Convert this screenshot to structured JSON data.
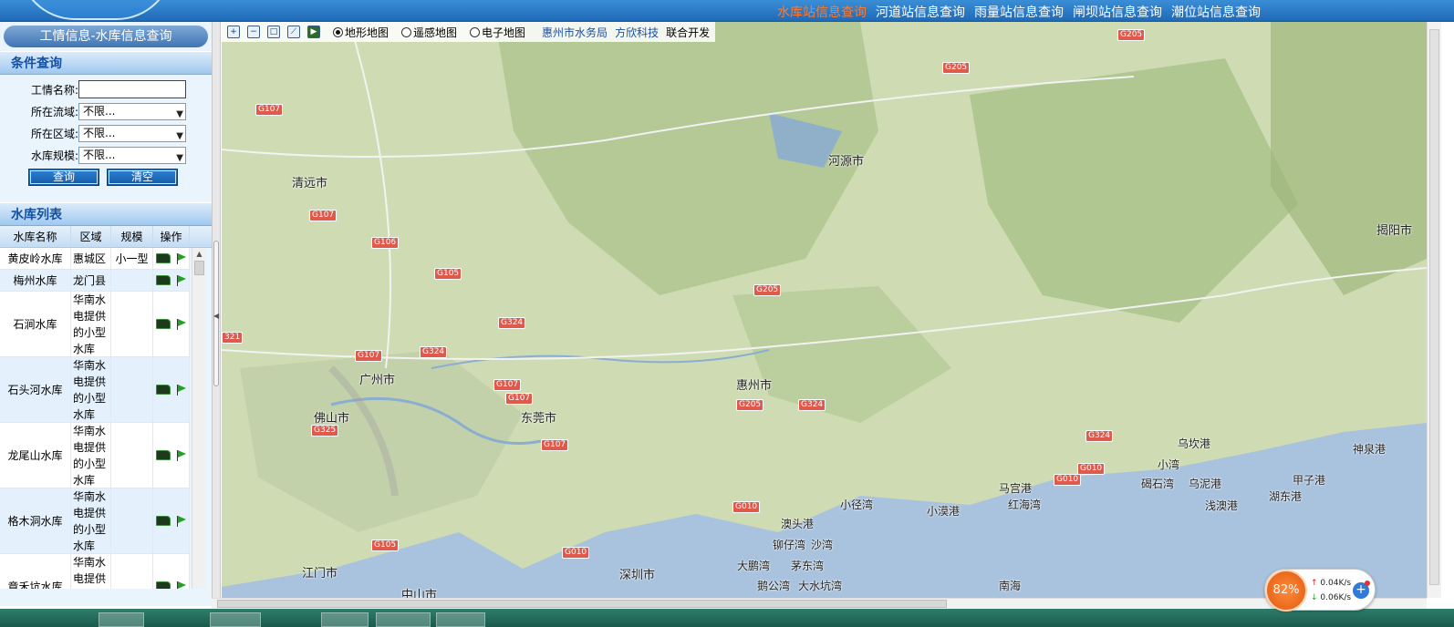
{
  "header": {
    "links": [
      "水库站信息查询",
      "河道站信息查询",
      "雨量站信息查询",
      "闸坝站信息查询",
      "潮位站信息查询"
    ],
    "active_index": 0,
    "accent_color": "#ff7a2e"
  },
  "sidebar": {
    "page_title": "工情信息-水库信息查询",
    "condition_title": "条件查询",
    "fields": {
      "name_label": "工情名称:",
      "name_value": "",
      "basin_label": "所在流域:",
      "basin_value": "不限...",
      "region_label": "所在区域:",
      "region_value": "不限...",
      "scale_label": "水库规模:",
      "scale_value": "不限..."
    },
    "query_button": "查询",
    "clear_button": "清空",
    "list_title": "水库列表",
    "columns": [
      "水库名称",
      "区域",
      "规模",
      "操作"
    ],
    "rows": [
      {
        "name": "黄皮岭水库",
        "region": "惠城区",
        "scale": "小一型"
      },
      {
        "name": "梅州水库",
        "region": "龙门县",
        "scale": ""
      },
      {
        "name": "石涧水库",
        "region": "华南水电提供的小型水库",
        "scale": ""
      },
      {
        "name": "石头河水库",
        "region": "华南水电提供的小型水库",
        "scale": ""
      },
      {
        "name": "龙尾山水库",
        "region": "华南水电提供的小型水库",
        "scale": ""
      },
      {
        "name": "格木洞水库",
        "region": "华南水电提供的小型水库",
        "scale": ""
      },
      {
        "name": "章禾坑水库",
        "region": "华南水电提供的小型水库",
        "scale": ""
      }
    ]
  },
  "map": {
    "tools": [
      "zoom-in",
      "zoom-out",
      "full-extent",
      "measure",
      "pan"
    ],
    "layers": [
      "地形地图",
      "遥感地图",
      "电子地图"
    ],
    "selected_layer": 0,
    "credit_1": "惠州市水务局",
    "credit_2": "方欣科技",
    "credit_3": "联合开发",
    "places": [
      "清远市",
      "河源市",
      "揭阳市",
      "广州市",
      "佛山市",
      "东莞市",
      "惠州市",
      "江门市",
      "中山市",
      "深圳市",
      "小径湾",
      "小漠港",
      "马宫港",
      "红海湾",
      "乌坎港",
      "小湾",
      "碣石湾",
      "乌泥港",
      "甲子港",
      "神泉港",
      "浅澳港",
      "湖东港",
      "澳头港",
      "铆仔湾",
      "沙湾",
      "大鹏湾",
      "茅东湾",
      "鹅公湾",
      "大水坑湾",
      "南海"
    ],
    "roads": [
      "G205",
      "G205",
      "G107",
      "G107",
      "G106",
      "G105",
      "G205",
      "G324",
      "G324",
      "G107",
      "G107",
      "G107",
      "G205",
      "G324",
      "G325",
      "G107",
      "G324",
      "G010",
      "G010",
      "G010",
      "G105",
      "G010",
      "321"
    ]
  },
  "net_widget": {
    "percent": "82%",
    "up": "0.04K/s",
    "down": "0.06K/s"
  }
}
